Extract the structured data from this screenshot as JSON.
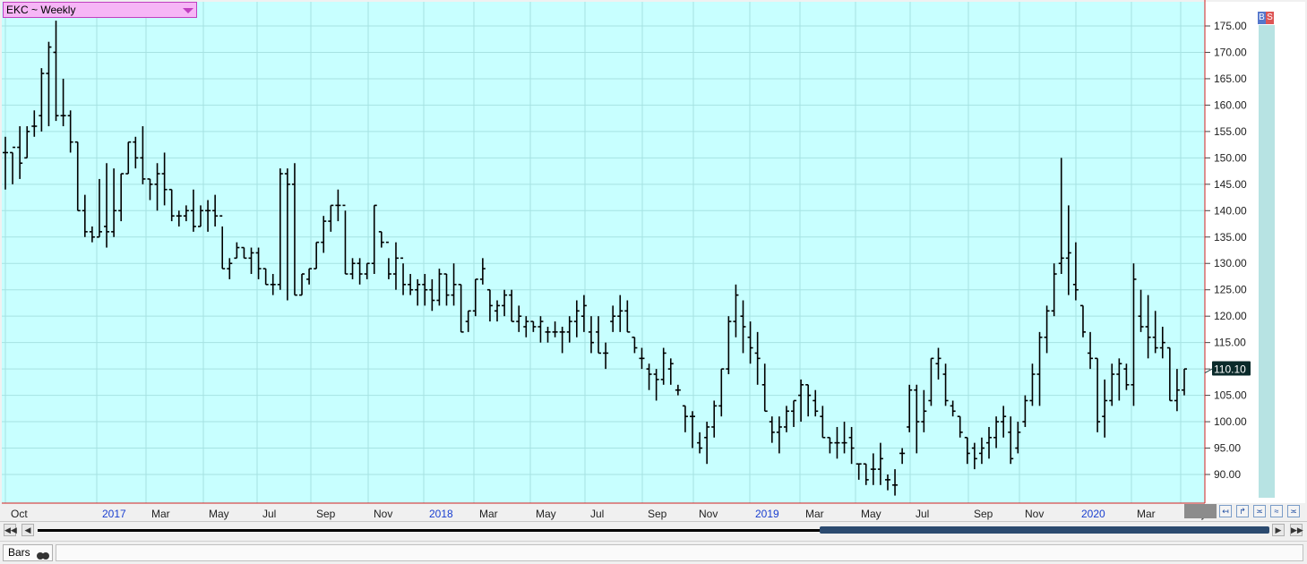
{
  "symbol_selector": {
    "label": "EKC ~ Weekly"
  },
  "toolbar": {
    "buy_label": "B",
    "sell_label": "S"
  },
  "status": {
    "chart_style_label": "Bars"
  },
  "colors": {
    "background": "#c8ffff",
    "grid": "#a6e2e2",
    "bars": "#000000",
    "axis_line": "#d32020",
    "year_label": "#1a3fd0",
    "price_box": "#0a2a2a"
  },
  "chart_data": {
    "type": "ohlc",
    "title": "EKC ~ Weekly",
    "y_axis": {
      "ticks": [
        90,
        95,
        100,
        105,
        110,
        115,
        120,
        125,
        130,
        135,
        140,
        145,
        150,
        155,
        160,
        165,
        170,
        175
      ],
      "tick_labels": [
        "90.00",
        "95.00",
        "100.00",
        "105.00",
        "110.00",
        "115.00",
        "120.00",
        "125.00",
        "130.00",
        "135.00",
        "140.00",
        "145.00",
        "150.00",
        "155.00",
        "160.00",
        "165.00",
        "170.00",
        "175.00"
      ],
      "ylim": [
        85,
        180
      ],
      "position": "right"
    },
    "x_axis": {
      "labels": [
        "Oct",
        "2017",
        "Mar",
        "May",
        "Jul",
        "Sep",
        "Nov",
        "2018",
        "Mar",
        "May",
        "Jul",
        "Sep",
        "Nov",
        "2019",
        "Mar",
        "May",
        "Jul",
        "Sep",
        "Nov",
        "2020",
        "Mar",
        "May"
      ],
      "year_labels": [
        "2017",
        "2018",
        "2019",
        "2020"
      ]
    },
    "last_price": "110.10",
    "grid": true,
    "bars": [
      [
        154,
        144,
        151,
        151
      ],
      [
        151,
        145,
        151,
        152
      ],
      [
        156,
        146,
        152,
        149
      ],
      [
        156,
        150,
        150,
        155
      ],
      [
        159,
        154,
        156,
        156
      ],
      [
        167,
        155,
        158,
        166
      ],
      [
        172,
        156,
        166,
        171
      ],
      [
        176,
        157,
        170,
        158
      ],
      [
        165,
        156,
        158,
        158
      ],
      [
        159,
        151,
        158,
        153
      ],
      [
        153,
        140,
        153,
        140
      ],
      [
        143,
        135,
        140,
        136
      ],
      [
        137,
        134,
        136,
        135
      ],
      [
        146,
        135,
        135,
        136
      ],
      [
        149,
        133,
        137,
        136
      ],
      [
        148,
        135,
        136,
        140
      ],
      [
        147,
        138,
        140,
        147
      ],
      [
        153,
        147,
        147,
        153
      ],
      [
        154,
        148,
        153,
        150
      ],
      [
        156,
        145,
        150,
        146
      ],
      [
        146,
        142,
        146,
        145
      ],
      [
        149,
        140,
        145,
        147
      ],
      [
        151,
        141,
        147,
        144
      ],
      [
        144,
        138,
        144,
        139
      ],
      [
        140,
        137,
        139,
        139
      ],
      [
        141,
        138,
        139,
        140
      ],
      [
        144,
        136,
        140,
        137
      ],
      [
        141,
        137,
        137,
        140
      ],
      [
        142,
        136,
        140,
        140
      ],
      [
        143,
        137,
        140,
        139
      ],
      [
        137,
        129,
        139,
        129
      ],
      [
        131,
        127,
        129,
        130
      ],
      [
        134,
        131,
        131,
        133
      ],
      [
        133,
        131,
        133,
        131
      ],
      [
        133,
        128,
        131,
        132
      ],
      [
        133,
        127,
        132,
        129
      ],
      [
        129,
        126,
        129,
        126
      ],
      [
        128,
        124,
        126,
        126
      ],
      [
        148,
        125,
        126,
        147
      ],
      [
        148,
        123,
        147,
        145
      ],
      [
        149,
        124,
        145,
        124
      ],
      [
        128,
        124,
        124,
        128
      ],
      [
        129,
        126,
        127,
        129
      ],
      [
        134,
        129,
        129,
        134
      ],
      [
        139,
        132,
        134,
        138
      ],
      [
        141,
        136,
        138,
        141
      ],
      [
        144,
        138,
        141,
        141
      ],
      [
        140,
        128,
        141,
        128
      ],
      [
        131,
        127,
        128,
        130
      ],
      [
        131,
        126,
        130,
        128
      ],
      [
        130,
        127,
        128,
        130
      ],
      [
        141,
        128,
        130,
        141
      ],
      [
        136,
        133,
        136,
        134
      ],
      [
        131,
        127,
        134,
        128
      ],
      [
        134,
        125,
        128,
        131
      ],
      [
        130,
        124,
        131,
        126
      ],
      [
        128,
        124,
        126,
        125
      ],
      [
        127,
        122,
        125,
        126
      ],
      [
        128,
        122,
        126,
        125
      ],
      [
        127,
        121,
        125,
        123
      ],
      [
        129,
        122,
        123,
        128
      ],
      [
        128,
        122,
        128,
        124
      ],
      [
        130,
        122,
        124,
        126
      ],
      [
        126,
        117,
        126,
        117
      ],
      [
        121,
        117,
        119,
        121
      ],
      [
        127,
        120,
        121,
        127
      ],
      [
        131,
        126,
        127,
        129
      ],
      [
        125,
        119,
        125,
        122
      ],
      [
        123,
        119,
        121,
        122
      ],
      [
        125,
        120,
        122,
        124
      ],
      [
        125,
        119,
        124,
        119
      ],
      [
        122,
        117,
        119,
        120
      ],
      [
        120,
        116,
        118,
        119
      ],
      [
        119,
        117,
        119,
        118
      ],
      [
        120,
        115,
        118,
        119
      ],
      [
        118,
        115,
        117,
        117
      ],
      [
        119,
        116,
        117,
        117
      ],
      [
        118,
        113,
        117,
        117
      ],
      [
        120,
        115,
        117,
        119
      ],
      [
        123,
        116,
        119,
        121
      ],
      [
        124,
        117,
        120,
        122
      ],
      [
        120,
        113,
        117,
        115
      ],
      [
        120,
        113,
        117,
        113
      ],
      [
        115,
        110,
        113,
        113
      ],
      [
        122,
        117,
        119,
        120
      ],
      [
        124,
        117,
        120,
        121
      ],
      [
        123,
        117,
        121,
        117
      ],
      [
        116,
        113,
        116,
        114
      ],
      [
        114,
        110,
        112,
        112
      ],
      [
        111,
        106,
        110,
        109
      ],
      [
        110,
        104,
        109,
        108
      ],
      [
        114,
        107,
        108,
        113
      ],
      [
        112,
        107,
        110,
        111
      ],
      [
        107,
        105,
        106,
        106
      ],
      [
        103,
        98,
        103,
        101
      ],
      [
        102,
        95,
        101,
        101
      ],
      [
        98,
        94,
        96,
        95
      ],
      [
        100,
        92,
        97,
        99
      ],
      [
        104,
        97,
        99,
        103
      ],
      [
        110,
        101,
        103,
        110
      ],
      [
        120,
        109,
        110,
        119
      ],
      [
        126,
        116,
        119,
        124
      ],
      [
        123,
        113,
        120,
        118
      ],
      [
        119,
        111,
        116,
        114
      ],
      [
        117,
        107,
        113,
        112
      ],
      [
        111,
        102,
        107,
        102
      ],
      [
        101,
        96,
        100,
        98
      ],
      [
        101,
        94,
        98,
        99
      ],
      [
        103,
        98,
        99,
        102
      ],
      [
        104,
        99,
        102,
        104
      ],
      [
        108,
        100,
        105,
        107
      ],
      [
        107,
        101,
        107,
        105
      ],
      [
        106,
        101,
        104,
        102
      ],
      [
        103,
        97,
        101,
        97
      ],
      [
        97,
        94,
        97,
        96
      ],
      [
        99,
        93,
        96,
        96
      ],
      [
        100,
        94,
        96,
        96
      ],
      [
        99,
        92,
        97,
        95
      ],
      [
        92,
        89,
        92,
        92
      ],
      [
        92,
        88,
        92,
        89
      ],
      [
        94,
        88,
        91,
        91
      ],
      [
        96,
        88,
        91,
        93
      ],
      [
        90,
        87,
        89,
        89
      ],
      [
        91,
        86,
        88,
        88
      ],
      [
        95,
        92,
        94,
        94
      ],
      [
        107,
        98,
        99,
        106
      ],
      [
        107,
        94,
        106,
        100
      ],
      [
        106,
        98,
        100,
        102
      ],
      [
        112,
        103,
        104,
        112
      ],
      [
        114,
        108,
        111,
        112
      ],
      [
        111,
        103,
        109,
        104
      ],
      [
        104,
        101,
        103,
        102
      ],
      [
        101,
        97,
        101,
        98
      ],
      [
        97,
        92,
        97,
        94
      ],
      [
        96,
        91,
        95,
        93
      ],
      [
        97,
        92,
        94,
        95
      ],
      [
        99,
        93,
        96,
        97
      ],
      [
        101,
        95,
        97,
        100
      ],
      [
        103,
        97,
        100,
        101
      ],
      [
        101,
        92,
        98,
        93
      ],
      [
        100,
        94,
        95,
        98
      ],
      [
        105,
        99,
        100,
        104
      ],
      [
        111,
        103,
        104,
        109
      ],
      [
        117,
        103,
        109,
        116
      ],
      [
        122,
        113,
        116,
        121
      ],
      [
        130,
        120,
        121,
        128
      ],
      [
        150,
        128,
        130,
        131
      ],
      [
        141,
        124,
        131,
        132
      ],
      [
        134,
        123,
        126,
        125
      ],
      [
        122,
        116,
        122,
        117
      ],
      [
        117,
        110,
        113,
        112
      ],
      [
        112,
        98,
        112,
        100
      ],
      [
        108,
        97,
        101,
        104
      ],
      [
        111,
        103,
        104,
        109
      ],
      [
        112,
        104,
        109,
        111
      ],
      [
        111,
        106,
        110,
        107
      ],
      [
        130,
        103,
        107,
        127
      ],
      [
        125,
        117,
        120,
        118
      ],
      [
        124,
        112,
        118,
        116
      ],
      [
        121,
        113,
        116,
        114
      ],
      [
        118,
        112,
        114,
        115
      ],
      [
        114,
        104,
        114,
        104
      ],
      [
        110,
        102,
        104,
        106
      ],
      [
        110,
        105,
        106,
        110
      ]
    ]
  }
}
